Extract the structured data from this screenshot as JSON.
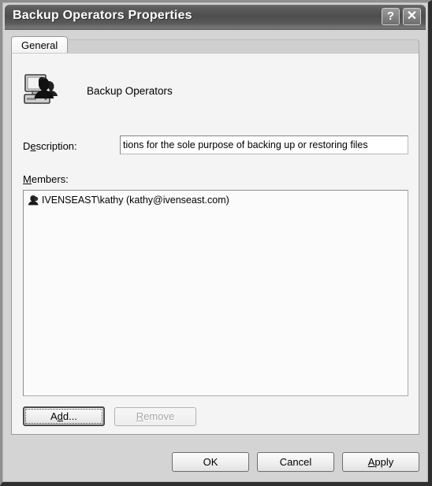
{
  "window": {
    "title": "Backup Operators Properties",
    "help_button": "?",
    "close_button": "✕"
  },
  "tabs": [
    {
      "label": "General",
      "selected": true
    }
  ],
  "general": {
    "group_icon": "group-computer-icon",
    "group_name": "Backup Operators",
    "description": {
      "label_prefix": "D",
      "label_accel": "e",
      "label_suffix": "scription:",
      "label_full": "Description:",
      "value": "tions for the sole purpose of backing up or restoring files",
      "placeholder": ""
    },
    "members": {
      "label_accel": "M",
      "label_suffix": "embers:",
      "label_full": "Members:",
      "items": [
        {
          "icon": "user-icon",
          "text": "IVENSEAST\\kathy (kathy@ivenseast.com)"
        }
      ]
    },
    "buttons": {
      "add": {
        "prefix": "A",
        "accel": "d",
        "suffix": "d...",
        "full": "Add...",
        "enabled": true,
        "focused": true
      },
      "remove": {
        "accel": "R",
        "suffix": "emove",
        "full": "Remove",
        "enabled": false,
        "focused": false
      }
    }
  },
  "footer": {
    "ok": "OK",
    "cancel": "Cancel",
    "apply_accel": "A",
    "apply_suffix": "pply",
    "apply_full": "Apply"
  },
  "colors": {
    "title_bar": "#4e4e4e",
    "dialog_face": "#d4d4d4",
    "panel_face": "#f4f4f4",
    "list_background": "#fbfbfb",
    "field_background": "#ffffff",
    "disabled_text": "#a6a6a6",
    "border": "#8d8d8d"
  }
}
